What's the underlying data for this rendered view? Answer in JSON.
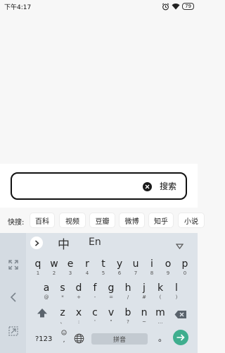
{
  "status_bar": {
    "time": "下午4:17",
    "battery": "79"
  },
  "search": {
    "value": "",
    "button_label": "搜索"
  },
  "quick_bar": {
    "label": "快搜:",
    "items": [
      "百科",
      "视频",
      "豆瓣",
      "微博",
      "知乎",
      "小说"
    ]
  },
  "keyboard": {
    "lang_chinese": "中",
    "lang_english": "En",
    "row1": [
      {
        "key": "q",
        "sub": "1"
      },
      {
        "key": "w",
        "sub": "2"
      },
      {
        "key": "e",
        "sub": "3"
      },
      {
        "key": "r",
        "sub": "4"
      },
      {
        "key": "t",
        "sub": "5"
      },
      {
        "key": "y",
        "sub": "6"
      },
      {
        "key": "u",
        "sub": "7"
      },
      {
        "key": "i",
        "sub": "8"
      },
      {
        "key": "o",
        "sub": "9"
      },
      {
        "key": "p",
        "sub": "0"
      }
    ],
    "row2": [
      {
        "key": "a",
        "sub": "@"
      },
      {
        "key": "s",
        "sub": "*"
      },
      {
        "key": "d",
        "sub": "+"
      },
      {
        "key": "f",
        "sub": "-"
      },
      {
        "key": "g",
        "sub": "="
      },
      {
        "key": "h",
        "sub": "/"
      },
      {
        "key": "j",
        "sub": "#"
      },
      {
        "key": "k",
        "sub": "("
      },
      {
        "key": "l",
        "sub": ")"
      }
    ],
    "row3": [
      {
        "key": "z",
        "sub": "、"
      },
      {
        "key": "x",
        "sub": ":"
      },
      {
        "key": "c",
        "sub": "'"
      },
      {
        "key": "v",
        "sub": "\""
      },
      {
        "key": "b",
        "sub": "?"
      },
      {
        "key": "n",
        "sub": "~"
      },
      {
        "key": "m",
        "sub": "…"
      }
    ],
    "num_label": "?123",
    "space_label": "拼音",
    "period_label": "。"
  },
  "colors": {
    "enter": "#3fae8e",
    "keyboard_bg": "#dde3e9"
  }
}
